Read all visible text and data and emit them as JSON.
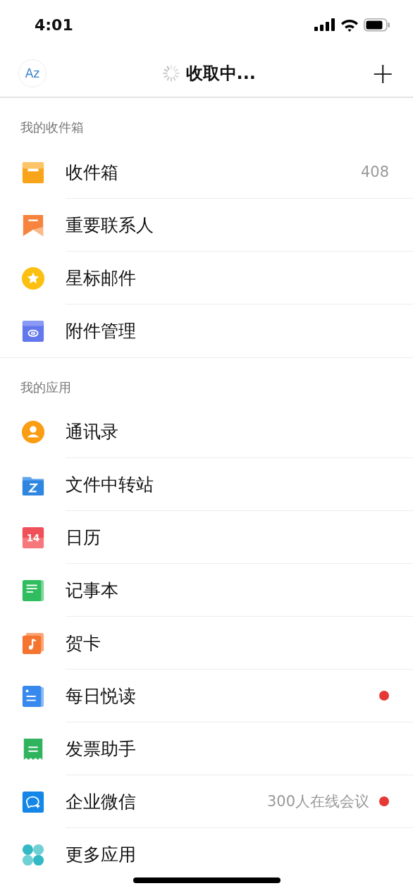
{
  "status_bar": {
    "time": "4:01"
  },
  "header": {
    "avatar": "Az",
    "title": "收取中...",
    "loading": true,
    "add_button": "+"
  },
  "mailbox_section": {
    "title": "我的收件箱",
    "items": [
      {
        "label": "收件箱",
        "count": "408"
      },
      {
        "label": "重要联系人"
      },
      {
        "label": "星标邮件"
      },
      {
        "label": "附件管理"
      }
    ]
  },
  "apps_section": {
    "title": "我的应用",
    "items": [
      {
        "label": "通讯录",
        "new_dot": false
      },
      {
        "label": "文件中转站",
        "new_dot": false
      },
      {
        "label": "日历",
        "icon_text": "14",
        "new_dot": false
      },
      {
        "label": "记事本",
        "new_dot": false
      },
      {
        "label": "贺卡",
        "new_dot": false
      },
      {
        "label": "每日悦读",
        "new_dot": true
      },
      {
        "label": "发票助手",
        "new_dot": false
      },
      {
        "label": "企业微信",
        "detail": "300人在线会议",
        "new_dot": true
      },
      {
        "label": "更多应用",
        "new_dot": false
      }
    ]
  }
}
